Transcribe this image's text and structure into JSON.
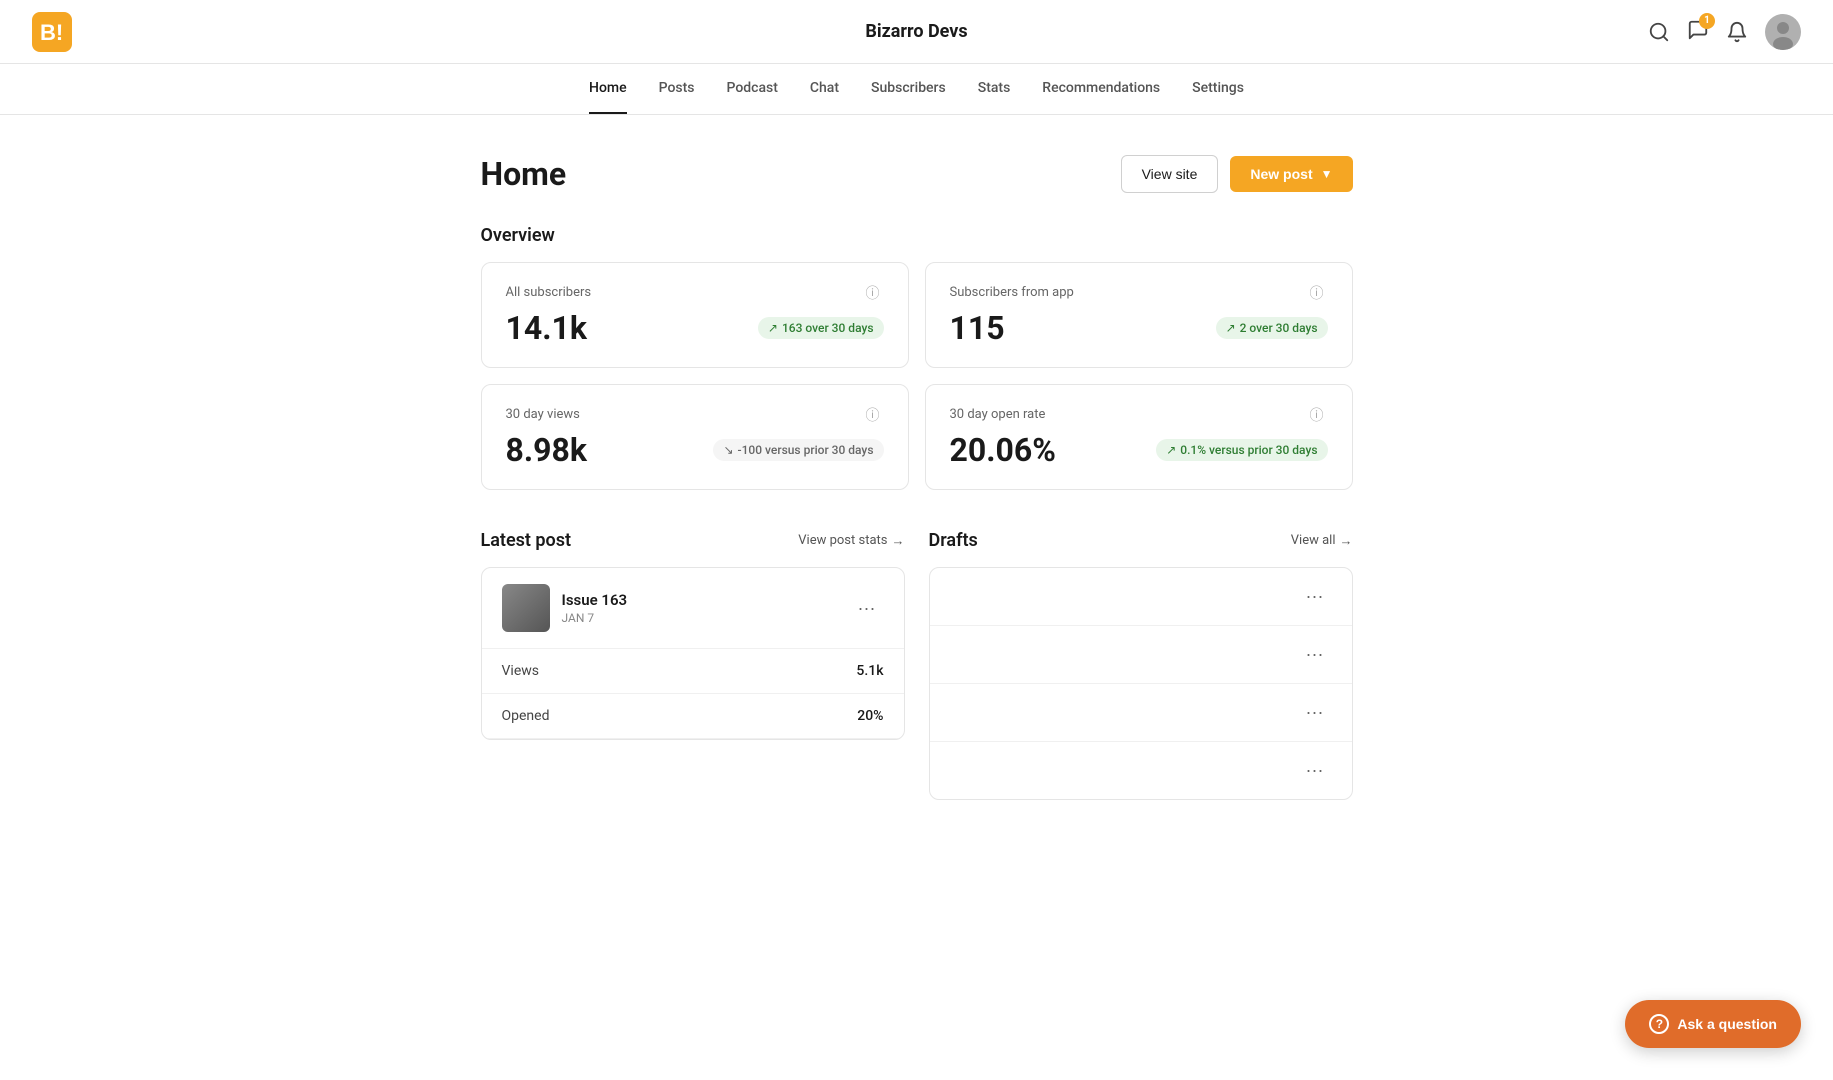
{
  "site": {
    "name": "Bizarro Devs"
  },
  "header": {
    "logo_alt": "Bizarro Devs logo",
    "notification_count": "1",
    "avatar_label": "User avatar"
  },
  "nav": {
    "items": [
      {
        "label": "Home",
        "active": true
      },
      {
        "label": "Posts",
        "active": false
      },
      {
        "label": "Podcast",
        "active": false
      },
      {
        "label": "Chat",
        "active": false
      },
      {
        "label": "Subscribers",
        "active": false
      },
      {
        "label": "Stats",
        "active": false
      },
      {
        "label": "Recommendations",
        "active": false
      },
      {
        "label": "Settings",
        "active": false
      }
    ]
  },
  "page": {
    "title": "Home",
    "view_site_label": "View site",
    "new_post_label": "New post"
  },
  "overview": {
    "section_title": "Overview",
    "stats": [
      {
        "label": "All subscribers",
        "value": "14.1k",
        "badge": "163 over 30 days",
        "badge_type": "positive"
      },
      {
        "label": "Subscribers from app",
        "value": "115",
        "badge": "2 over 30 days",
        "badge_type": "positive"
      },
      {
        "label": "30 day views",
        "value": "8.98k",
        "badge": "-100 versus prior 30 days",
        "badge_type": "negative"
      },
      {
        "label": "30 day open rate",
        "value": "20.06%",
        "badge": "0.1% versus prior 30 days",
        "badge_type": "positive"
      }
    ]
  },
  "latest_post": {
    "section_title": "Latest post",
    "view_link": "View post stats",
    "post": {
      "title": "Issue 163",
      "date": "JAN 7"
    },
    "stats": [
      {
        "label": "Views",
        "value": "5.1k"
      },
      {
        "label": "Opened",
        "value": "20%"
      }
    ]
  },
  "drafts": {
    "section_title": "Drafts",
    "view_link": "View all",
    "items": [
      {
        "id": 1
      },
      {
        "id": 2
      },
      {
        "id": 3
      },
      {
        "id": 4
      }
    ]
  },
  "ask_button": {
    "label": "Ask a question"
  }
}
